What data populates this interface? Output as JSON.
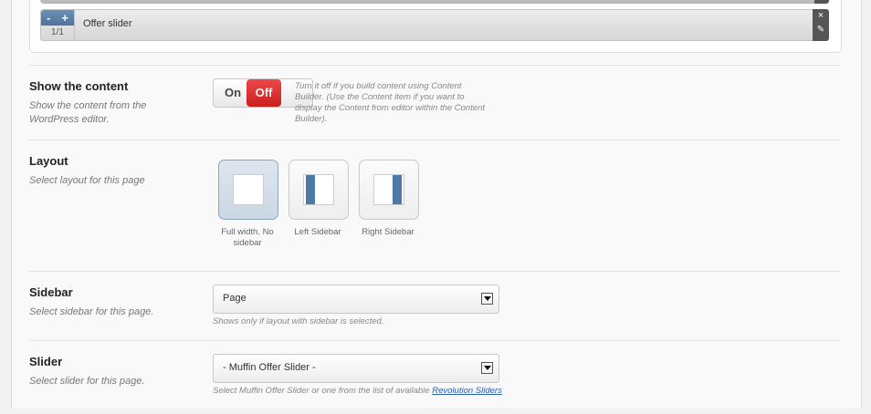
{
  "builder": {
    "item": {
      "minus": "-",
      "plus": "+",
      "size": "1/1",
      "title": "Offer slider",
      "close_icon": "×",
      "edit_icon": "✎"
    }
  },
  "show_content": {
    "label": "Show the content",
    "desc": "Show the content from the WordPress editor.",
    "toggle_on": "On",
    "toggle_off": "Off",
    "state": "Off",
    "note": "Turn it off if you build content using Content Builder. (Use the Content item if you want to display the Content from editor within the Content Builder)."
  },
  "layout": {
    "label": "Layout",
    "desc": "Select layout for this page",
    "options": [
      {
        "caption": "Full width. No sidebar",
        "selected": true
      },
      {
        "caption": "Left Sidebar",
        "selected": false
      },
      {
        "caption": "Right Sidebar",
        "selected": false
      }
    ]
  },
  "sidebar": {
    "label": "Sidebar",
    "desc": "Select sidebar for this page.",
    "value": "Page",
    "note": "Shows only if layout with sidebar is selected."
  },
  "slider": {
    "label": "Slider",
    "desc": "Select slider for this page.",
    "value": "- Muffin Offer Slider -",
    "note_prefix": "Select Muffin Offer Slider or one from the list of available ",
    "note_link": "Revolution Sliders"
  },
  "colors": {
    "accent_blue": "#4f79a4",
    "toggle_off_red": "#d82a2a",
    "link": "#2a5db0"
  }
}
